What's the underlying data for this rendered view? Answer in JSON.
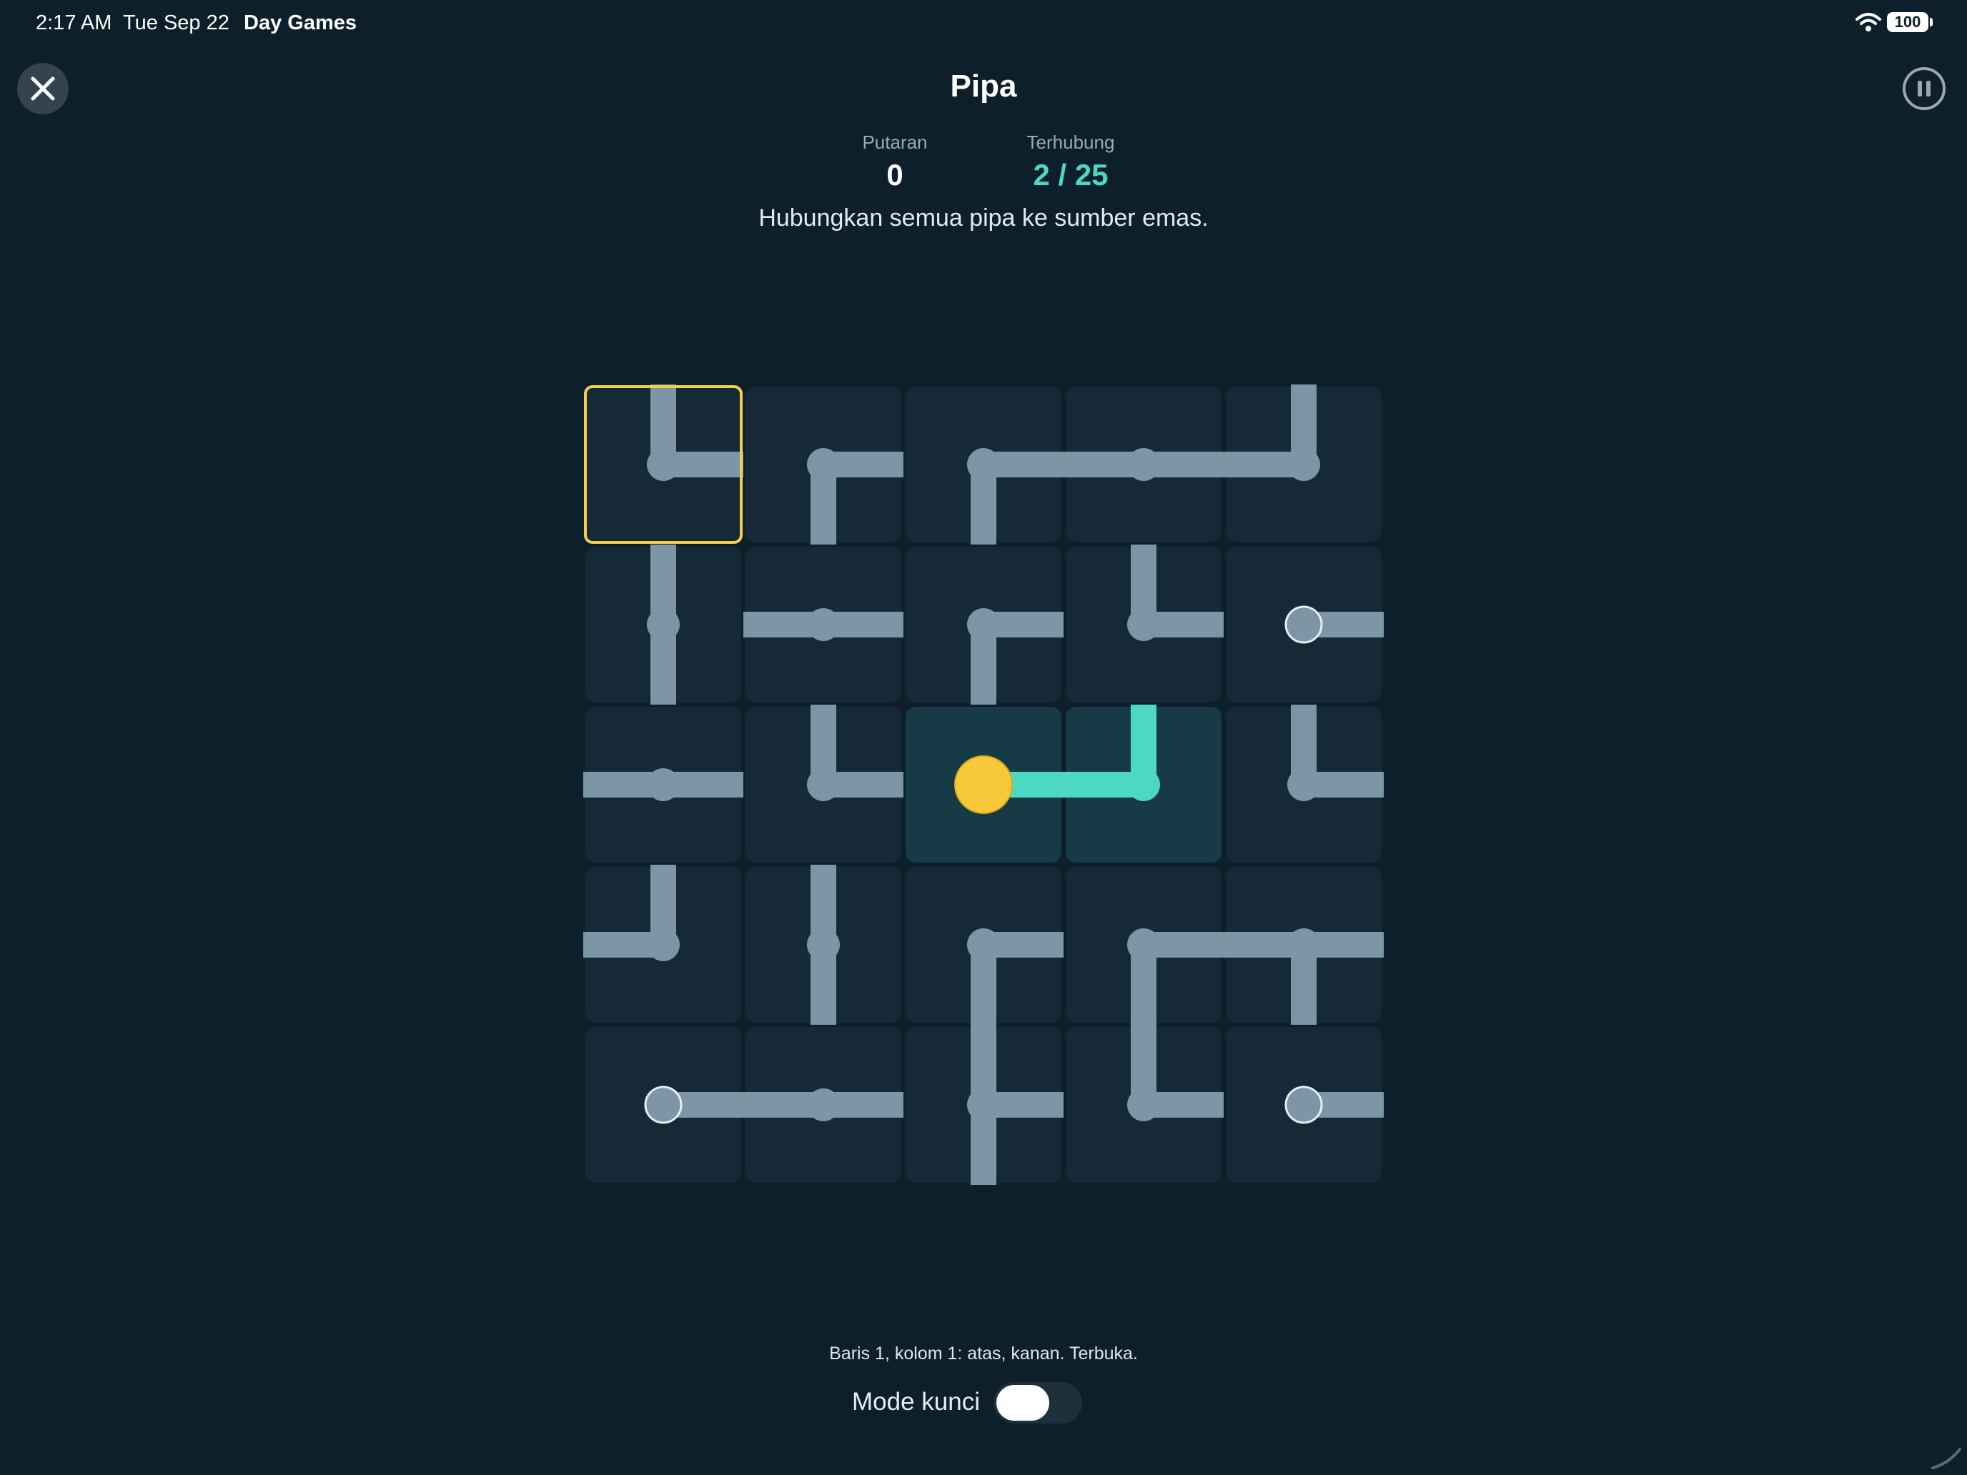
{
  "status_bar": {
    "time": "2:17 AM",
    "date": "Tue Sep 22",
    "app_name": "Day Games",
    "battery": "100"
  },
  "header": {
    "title": "Pipa",
    "close_icon": "close-icon",
    "pause_icon": "pause-icon"
  },
  "stats": {
    "rotations_label": "Putaran",
    "rotations_value": "0",
    "connected_label": "Terhubung",
    "connected_value": "2 / 25"
  },
  "instruction": "Hubungkan semua pipa ke sumber emas.",
  "board": {
    "rows": 5,
    "cols": 5,
    "selected": [
      1,
      1
    ],
    "tiles": [
      [
        {
          "e": [
            "N",
            "E"
          ]
        },
        {
          "e": [
            "E",
            "S"
          ]
        },
        {
          "e": [
            "E",
            "S"
          ]
        },
        {
          "e": [
            "W",
            "E"
          ]
        },
        {
          "e": [
            "N",
            "W"
          ]
        }
      ],
      [
        {
          "e": [
            "N",
            "S"
          ]
        },
        {
          "e": [
            "W",
            "E"
          ]
        },
        {
          "e": [
            "E",
            "S"
          ]
        },
        {
          "e": [
            "N",
            "E"
          ]
        },
        {
          "e": [
            "E"
          ],
          "term": true
        }
      ],
      [
        {
          "e": [
            "W",
            "E"
          ]
        },
        {
          "e": [
            "N",
            "E"
          ]
        },
        {
          "e": [
            "E"
          ],
          "source": true,
          "lit": true
        },
        {
          "e": [
            "N",
            "W"
          ],
          "lit": true
        },
        {
          "e": [
            "N",
            "E"
          ]
        }
      ],
      [
        {
          "e": [
            "N",
            "W"
          ]
        },
        {
          "e": [
            "N",
            "S"
          ]
        },
        {
          "e": [
            "E",
            "S"
          ]
        },
        {
          "e": [
            "E",
            "S"
          ]
        },
        {
          "e": [
            "W",
            "E",
            "S"
          ]
        }
      ],
      [
        {
          "e": [
            "E"
          ],
          "term": true
        },
        {
          "e": [
            "W",
            "E"
          ]
        },
        {
          "e": [
            "N",
            "E",
            "S"
          ]
        },
        {
          "e": [
            "N",
            "E"
          ]
        },
        {
          "e": [
            "E"
          ],
          "term": true
        }
      ]
    ]
  },
  "colors": {
    "background": "#0c1f2a",
    "tile": "#152a36",
    "pipe": "#7d96a5",
    "connected": "#4dd8c4",
    "source": "#f7c93a",
    "selection": "#f2d04a"
  },
  "footer": {
    "caption": "Baris 1, kolom 1: atas, kanan. Terbuka.",
    "lock_mode_label": "Mode kunci",
    "lock_mode_on": false
  }
}
